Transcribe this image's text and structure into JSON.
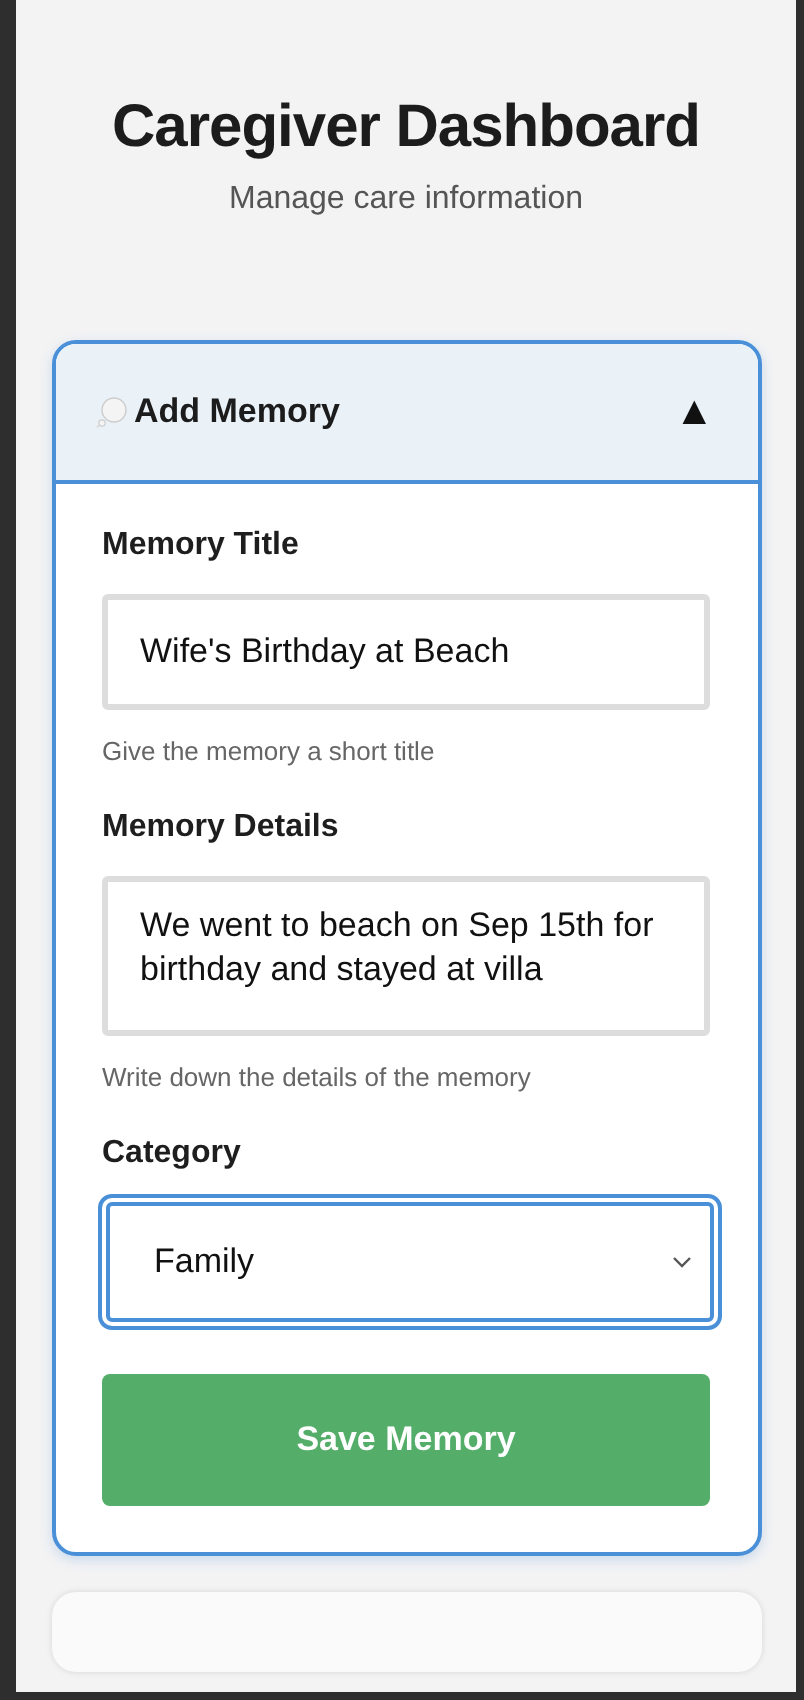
{
  "header": {
    "title": "Caregiver Dashboard",
    "subtitle": "Manage care information"
  },
  "panel": {
    "title": "Add Memory",
    "toggle": "▲",
    "expanded": true,
    "fields": [
      {
        "kind": "text",
        "label": "Memory Title",
        "value": "Wife's Birthday at Beach",
        "hint": "Give the memory a short title",
        "focused": false
      },
      {
        "kind": "textarea",
        "label": "Memory Details",
        "value": "We went to beach on Sep 15th for birthday and stayed at villa",
        "hint": "Write down the details of the memory",
        "focused": false
      },
      {
        "kind": "select",
        "label": "Category",
        "value": "Family",
        "focused": true
      }
    ],
    "button": "Save Memory"
  }
}
